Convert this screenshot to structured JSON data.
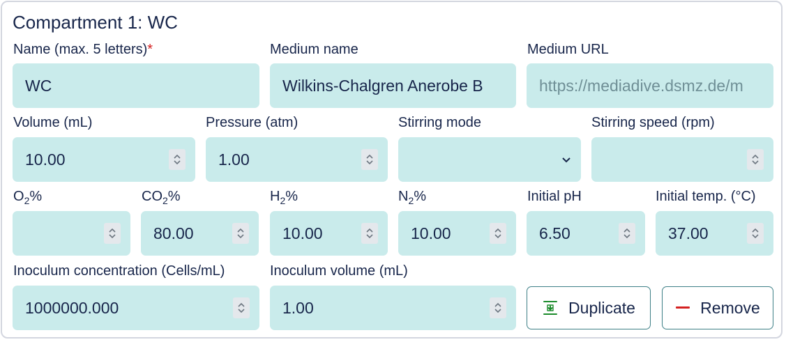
{
  "title": "Compartment 1: WC",
  "fields": {
    "name": {
      "label": "Name (max. 5 letters)",
      "required_mark": "*",
      "value": "WC"
    },
    "medium_name": {
      "label": "Medium name",
      "value": "Wilkins-Chalgren Anerobe B"
    },
    "medium_url": {
      "label": "Medium URL",
      "placeholder": "https://mediadive.dsmz.de/m"
    },
    "volume": {
      "label": "Volume (mL)",
      "value": "10.00"
    },
    "pressure": {
      "label": "Pressure (atm)",
      "value": "1.00"
    },
    "stirring_mode": {
      "label": "Stirring mode",
      "value": ""
    },
    "stirring_speed": {
      "label": "Stirring speed (rpm)",
      "value": ""
    },
    "o2": {
      "label_main": "O",
      "label_sub": "2",
      "label_suffix": "%",
      "value": ""
    },
    "co2": {
      "label_main": "CO",
      "label_sub": "2",
      "label_suffix": "%",
      "value": "80.00"
    },
    "h2": {
      "label_main": "H",
      "label_sub": "2",
      "label_suffix": "%",
      "value": "10.00"
    },
    "n2": {
      "label_main": "N",
      "label_sub": "2",
      "label_suffix": "%",
      "value": "10.00"
    },
    "initial_ph": {
      "label": "Initial pH",
      "value": "6.50"
    },
    "initial_temp": {
      "label": "Initial temp. (°C)",
      "value": "37.00"
    },
    "inoculum_concentration": {
      "label": "Inoculum concentration (Cells/mL)",
      "value": "1000000.000"
    },
    "inoculum_volume": {
      "label": "Inoculum volume (mL)",
      "value": "1.00"
    }
  },
  "buttons": {
    "duplicate": {
      "label": "Duplicate",
      "icon": "duplicate-icon",
      "color": "#1a8a2a"
    },
    "remove": {
      "label": "Remove",
      "icon": "minus-icon",
      "color": "#d42020"
    }
  },
  "colors": {
    "field_bg": "#c9ebeb",
    "text": "#17254a",
    "border": "#d3d6df",
    "button_border": "#3d7f86"
  }
}
